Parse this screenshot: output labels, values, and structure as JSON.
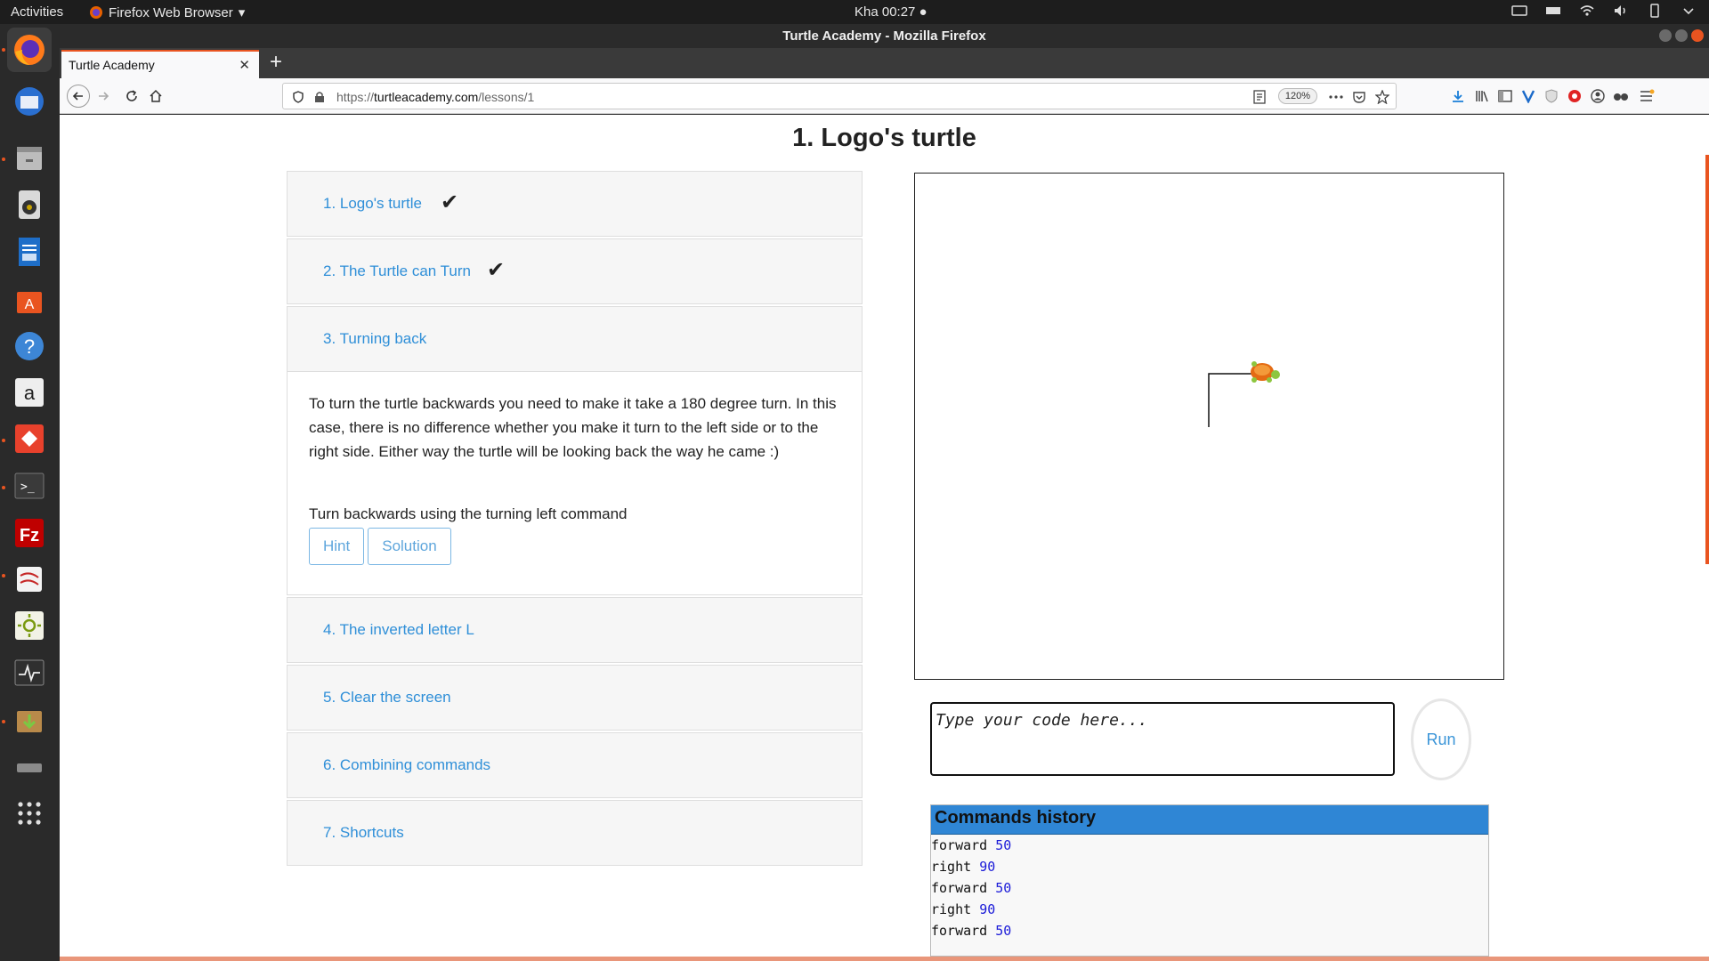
{
  "topbar": {
    "activities": "Activities",
    "app_name": "Firefox Web Browser",
    "clock": "Kha 00:27 ●"
  },
  "window": {
    "title": "Turtle Academy - Mozilla Firefox"
  },
  "tab": {
    "label": "Turtle Academy"
  },
  "address_bar": {
    "scheme": "https://",
    "host": "turtleacademy.com",
    "path": "/lessons/1",
    "zoom": "120%"
  },
  "page": {
    "title": "1. Logo's turtle"
  },
  "lessons": [
    {
      "label": "1. Logo's turtle",
      "completed": true
    },
    {
      "label": "2. The Turtle can Turn",
      "completed": true
    },
    {
      "label": "3. Turning back",
      "completed": false
    },
    {
      "label": "4. The inverted letter L",
      "completed": false
    },
    {
      "label": "5. Clear the screen",
      "completed": false
    },
    {
      "label": "6. Combining commands",
      "completed": false
    },
    {
      "label": "7. Shortcuts",
      "completed": false
    }
  ],
  "active_lesson": {
    "description": "To turn the turtle backwards you need to make it take a 180 degree turn. In this case, there is no difference whether you make it turn to the left side or to the right side. Either way the turtle will be looking back the way he came :)",
    "task": "Turn backwards using the turning left command",
    "hint_label": "Hint",
    "solution_label": "Solution"
  },
  "editor": {
    "placeholder": "Type your code here...",
    "run_label": "Run"
  },
  "history": {
    "title": "Commands history",
    "commands": [
      {
        "cmd": "forward",
        "arg": "50"
      },
      {
        "cmd": "right",
        "arg": "90"
      },
      {
        "cmd": "forward",
        "arg": "50"
      },
      {
        "cmd": "right",
        "arg": "90"
      },
      {
        "cmd": "forward",
        "arg": "50"
      }
    ]
  },
  "colors": {
    "accent": "#e95420",
    "link": "#2f8fd8",
    "history_header": "#2f86d5"
  }
}
